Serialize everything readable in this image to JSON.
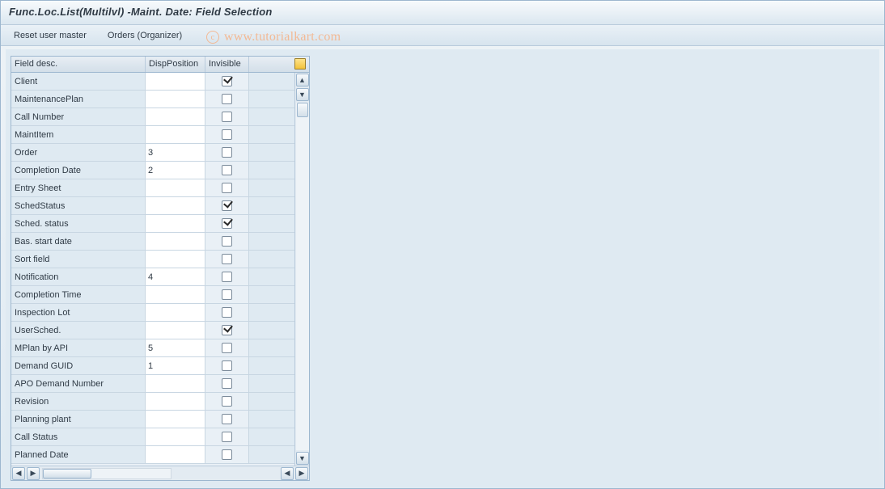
{
  "title": "Func.Loc.List(Multilvl) -Maint. Date: Field Selection",
  "toolbar": {
    "reset_user_master": "Reset user master",
    "orders_organizer": "Orders (Organizer)"
  },
  "watermark": "www.tutorialkart.com",
  "columns": {
    "field_desc": "Field desc.",
    "disp_position": "DispPosition",
    "invisible": "Invisible"
  },
  "rows": [
    {
      "desc": "Client",
      "pos": "",
      "invisible": true
    },
    {
      "desc": "MaintenancePlan",
      "pos": "",
      "invisible": false
    },
    {
      "desc": "Call Number",
      "pos": "",
      "invisible": false
    },
    {
      "desc": "MaintItem",
      "pos": "",
      "invisible": false
    },
    {
      "desc": "Order",
      "pos": "3",
      "invisible": false
    },
    {
      "desc": "Completion Date",
      "pos": "2",
      "invisible": false
    },
    {
      "desc": "Entry Sheet",
      "pos": "",
      "invisible": false
    },
    {
      "desc": "SchedStatus",
      "pos": "",
      "invisible": true
    },
    {
      "desc": "Sched. status",
      "pos": "",
      "invisible": true
    },
    {
      "desc": "Bas. start date",
      "pos": "",
      "invisible": false
    },
    {
      "desc": "Sort field",
      "pos": "",
      "invisible": false
    },
    {
      "desc": "Notification",
      "pos": "4",
      "invisible": false
    },
    {
      "desc": "Completion Time",
      "pos": "",
      "invisible": false
    },
    {
      "desc": "Inspection Lot",
      "pos": "",
      "invisible": false
    },
    {
      "desc": "UserSched.",
      "pos": "",
      "invisible": true
    },
    {
      "desc": "MPlan by API",
      "pos": "5",
      "invisible": false
    },
    {
      "desc": "Demand GUID",
      "pos": "1",
      "invisible": false
    },
    {
      "desc": "APO Demand Number",
      "pos": "",
      "invisible": false
    },
    {
      "desc": "Revision",
      "pos": "",
      "invisible": false
    },
    {
      "desc": "Planning plant",
      "pos": "",
      "invisible": false
    },
    {
      "desc": "Call Status",
      "pos": "",
      "invisible": false
    },
    {
      "desc": "Planned Date",
      "pos": "",
      "invisible": false
    }
  ]
}
